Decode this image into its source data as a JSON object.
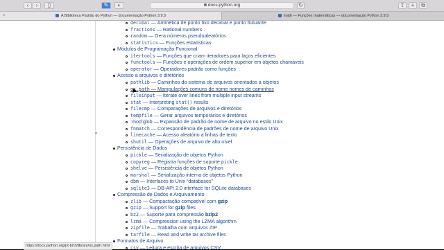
{
  "browser": {
    "address": "docs.python.org",
    "tabs": [
      {
        "title": "A Biblioteca Padrão do Python — documentação Python 3.9.5",
        "active": true
      },
      {
        "title": "math — Funções matemáticas — documentação Python 3.9.5",
        "active": false
      }
    ],
    "status_url": "https://docs.python.org/pt-br/3/library/os.path.html"
  },
  "top_line": {
    "module": "fractions",
    "desc": "Rational numbers"
  },
  "items": [
    {
      "kind": "item",
      "module": "decimal",
      "desc": "Aritmética de ponto fixo decimal e ponto flutuante"
    },
    {
      "kind": "item",
      "module": "fractions",
      "desc": "Rational numbers"
    },
    {
      "kind": "item",
      "module": "random",
      "desc": "Gera números pseudoaleatórios"
    },
    {
      "kind": "item",
      "module": "statistics",
      "desc": "Funções estatísticas"
    },
    {
      "kind": "section",
      "text": "Módulos de Programação Funcional"
    },
    {
      "kind": "item",
      "module": "itertools",
      "desc": "Funções que criam iteradores para laços eficientes"
    },
    {
      "kind": "item",
      "module": "functools",
      "desc": "Funções e operações de ordem superior em objetos chamáveis"
    },
    {
      "kind": "item",
      "module": "operator",
      "desc": "Operadores padrão como funções"
    },
    {
      "kind": "section",
      "text": "Acesso a arquivos e diretórios"
    },
    {
      "kind": "item",
      "module": "pathlib",
      "desc": "Caminhos do sistema de arquivos orientados a objetos"
    },
    {
      "kind": "item",
      "module": "os.path",
      "desc": "Manipulações comuns de nome nomes de caminhos",
      "hover": true
    },
    {
      "kind": "item",
      "module": "fileinput",
      "desc": "Iterate over lines from multiple input streams"
    },
    {
      "kind": "item",
      "module": "stat",
      "desc": "Interpreting ",
      "desc_mono": "stat()",
      "desc_tail": " results"
    },
    {
      "kind": "item",
      "module": "filecmp",
      "desc": "Comparações de arquivos e diretórios"
    },
    {
      "kind": "item",
      "module": "tempfile",
      "desc": "Gerar arquivos temporários e diretórios"
    },
    {
      "kind": "item",
      "module": ":mod:glob",
      "desc": "Expansão de padrão de nome de arquivo no estilo Unix",
      "plain_module": true
    },
    {
      "kind": "item",
      "module": "fnmatch",
      "desc": "Correspondência de padrões de nome de arquivo Unix"
    },
    {
      "kind": "item",
      "module": "linecache",
      "desc": "Acesso aleatório a linhas de texto"
    },
    {
      "kind": "item",
      "module": "shutil",
      "desc": "Operações de arquivo de alto nível"
    },
    {
      "kind": "section",
      "text": "Persistência de Dados"
    },
    {
      "kind": "item",
      "module": "pickle",
      "desc": "Serialização de objetos Python"
    },
    {
      "kind": "item",
      "module": "copyreg",
      "desc": "Registra funções de suporte ",
      "desc_mono": "pickle",
      "desc_tail": ""
    },
    {
      "kind": "item",
      "module": "shelve",
      "desc": "Persistência de objetos Python"
    },
    {
      "kind": "item",
      "module": "marshal",
      "desc": "Serialização interna de objetos Python"
    },
    {
      "kind": "item",
      "module": "dbm",
      "desc": "Interfaces to Unix “databases”"
    },
    {
      "kind": "item",
      "module": "sqlite3",
      "desc": "DB-API 2.0 interface for SQLite databases"
    },
    {
      "kind": "section",
      "text": "Compressão de Dados e Arquivamento"
    },
    {
      "kind": "item",
      "module": "zlib",
      "desc": "Compactação compatível com ",
      "desc_bold": "gzip"
    },
    {
      "kind": "item",
      "module": "gzip",
      "desc": "Support for ",
      "desc_bold": "gzip",
      "desc_tail": " files"
    },
    {
      "kind": "item",
      "module": "bz2",
      "desc": "Suporte para compressão ",
      "desc_bold": "bzip2"
    },
    {
      "kind": "item",
      "module": "lzma",
      "desc": "Compression using the LZMA algorithm"
    },
    {
      "kind": "item",
      "module": "zipfile",
      "desc": "Trabalha com arquivos ZIP"
    },
    {
      "kind": "item",
      "module": "tarfile",
      "desc": "Read and write tar archive files"
    },
    {
      "kind": "section",
      "text": "Formatos de Arquivo"
    },
    {
      "kind": "item",
      "module": "csv",
      "desc": "Leitura e escrita de arquivos CSV"
    }
  ],
  "dash": " — "
}
